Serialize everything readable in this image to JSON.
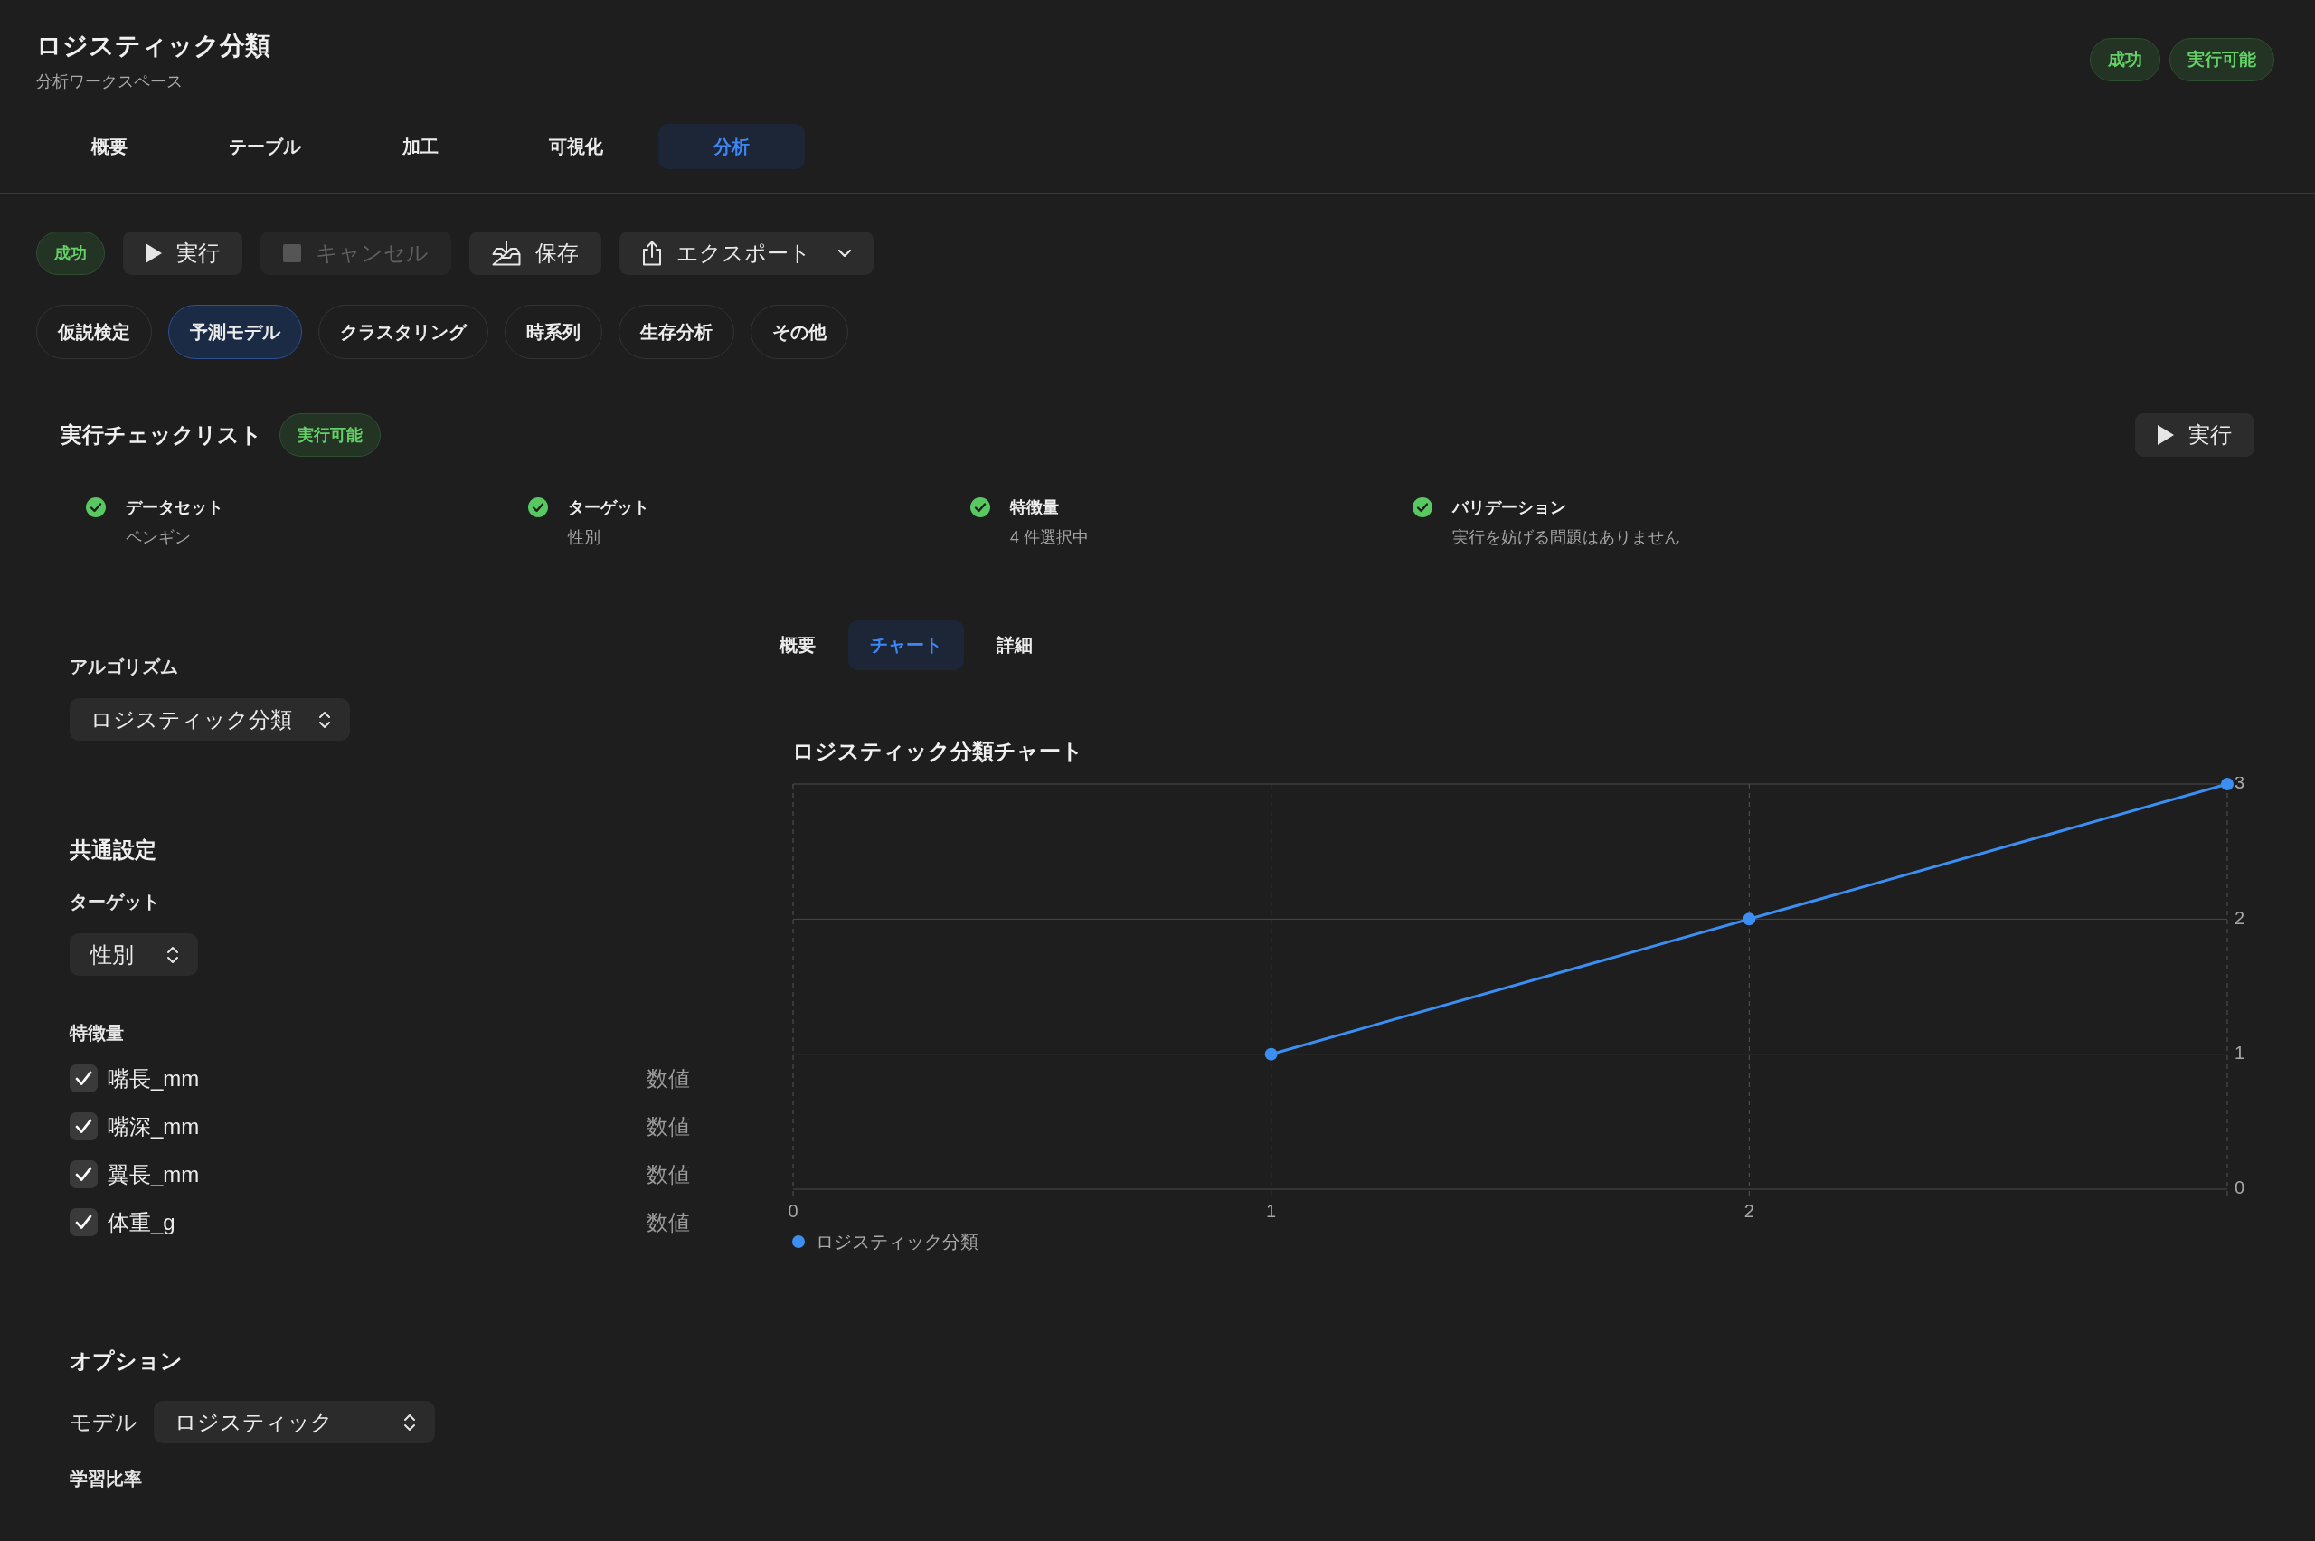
{
  "header": {
    "title": "ロジスティック分類",
    "subtitle": "分析ワークスペース",
    "badges": [
      "成功",
      "実行可能"
    ]
  },
  "tabs": [
    {
      "label": "概要",
      "selected": false
    },
    {
      "label": "テーブル",
      "selected": false
    },
    {
      "label": "加工",
      "selected": false
    },
    {
      "label": "可視化",
      "selected": false
    },
    {
      "label": "分析",
      "selected": true
    }
  ],
  "toolbar": {
    "status_badge": "成功",
    "buttons": [
      {
        "kind": "run",
        "label": "実行",
        "disabled": false,
        "has_menu": false
      },
      {
        "kind": "cancel",
        "label": "キャンセル",
        "disabled": true,
        "has_menu": false
      },
      {
        "kind": "save",
        "label": "保存",
        "disabled": false,
        "has_menu": false
      },
      {
        "kind": "export",
        "label": "エクスポート",
        "disabled": false,
        "has_menu": true
      }
    ]
  },
  "analysis_types": [
    {
      "label": "仮説検定",
      "selected": false
    },
    {
      "label": "予測モデル",
      "selected": true
    },
    {
      "label": "クラスタリング",
      "selected": false
    },
    {
      "label": "時系列",
      "selected": false
    },
    {
      "label": "生存分析",
      "selected": false
    },
    {
      "label": "その他",
      "selected": false
    }
  ],
  "checklist": {
    "title": "実行チェックリスト",
    "badge": "実行可能",
    "run_button": "実行",
    "items": [
      {
        "title": "データセット",
        "detail": "ペンギン",
        "done": true
      },
      {
        "title": "ターゲット",
        "detail": "性別",
        "done": true
      },
      {
        "title": "特徴量",
        "detail": "4 件選択中",
        "done": true
      },
      {
        "title": "バリデーション",
        "detail": "実行を妨げる問題はありません",
        "done": true
      }
    ]
  },
  "settings": {
    "algorithm": {
      "label": "アルゴリズム",
      "value": "ロジスティック分類"
    },
    "common": {
      "title": "共通設定",
      "target": {
        "label": "ターゲット",
        "value": "性別"
      },
      "features_label": "特徴量",
      "features": [
        {
          "name": "嘴長_mm",
          "type": "数値",
          "checked": true
        },
        {
          "name": "嘴深_mm",
          "type": "数値",
          "checked": true
        },
        {
          "name": "翼長_mm",
          "type": "数値",
          "checked": true
        },
        {
          "name": "体重_g",
          "type": "数値",
          "checked": true
        }
      ]
    },
    "options": {
      "title": "オプション",
      "model": {
        "label": "モデル",
        "value": "ロジスティック"
      },
      "train_ratio_label": "学習比率"
    }
  },
  "results": {
    "tabs": [
      {
        "label": "概要",
        "selected": false
      },
      {
        "label": "チャート",
        "selected": true
      },
      {
        "label": "詳細",
        "selected": false
      }
    ],
    "chart_data": {
      "type": "line",
      "title": "ロジスティック分類チャート",
      "x": [
        1,
        2,
        3
      ],
      "series": [
        {
          "name": "ロジスティック分類",
          "color": "#3b8ef2",
          "marker": "circle",
          "values": [
            1,
            2,
            3
          ]
        }
      ],
      "xlim": [
        0,
        3
      ],
      "ylim": [
        0,
        3
      ],
      "xticks": [
        0,
        1,
        2
      ],
      "yticks": [
        0,
        1,
        2,
        3
      ],
      "grid": true
    }
  }
}
